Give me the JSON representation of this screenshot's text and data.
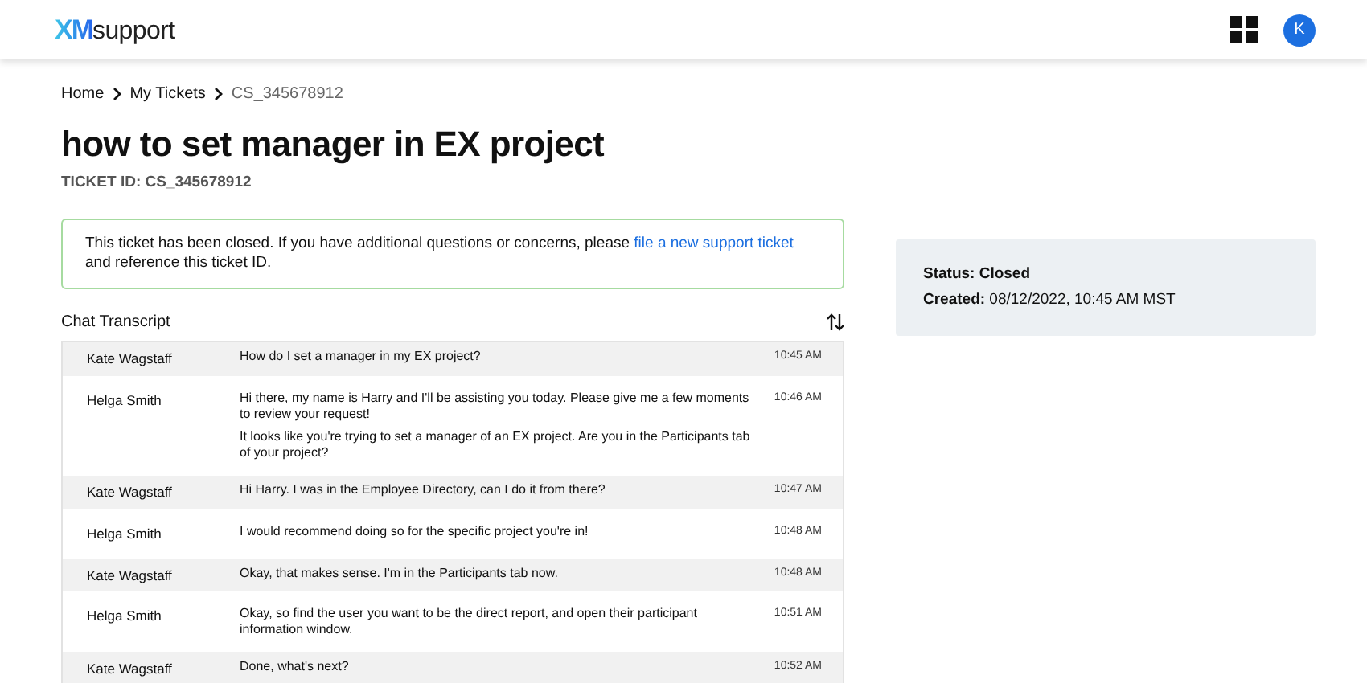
{
  "header": {
    "logo_mark": "XM",
    "logo_text": "support",
    "avatar": "K"
  },
  "breadcrumb": [
    {
      "label": "Home",
      "current": false
    },
    {
      "label": "My Tickets",
      "current": false
    },
    {
      "label": "CS_345678912",
      "current": true
    }
  ],
  "title": "how to set manager in EX project",
  "ticket_id": "TICKET ID: CS_345678912",
  "notice": {
    "text": "This ticket has been closed. If you have additional questions or concerns, please",
    "link": "file a new support ticket",
    "text_after": "and reference this ticket ID."
  },
  "transcript": {
    "heading": "Chat Transcript",
    "messages": [
      {
        "kind": "customer",
        "author": "Kate Wagstaff",
        "paragraphs": [
          "How do I set a manager in my EX project?"
        ],
        "time": "10:45 AM"
      },
      {
        "kind": "agent",
        "author": "Helga Smith",
        "paragraphs": [
          "Hi there, my name is Harry and I'll be assisting you today. Please give me a few moments to review your request!",
          "It looks like you're trying to set a manager of an EX project. Are you in the Participants tab of your project?"
        ],
        "time": "10:46 AM"
      },
      {
        "kind": "customer",
        "author": "Kate Wagstaff",
        "paragraphs": [
          "Hi Harry. I was in the Employee Directory, can I do it from there?"
        ],
        "time": "10:47 AM"
      },
      {
        "kind": "agent",
        "author": "Helga Smith",
        "paragraphs": [
          "I would recommend doing so for the specific project you're in!"
        ],
        "time": "10:48 AM"
      },
      {
        "kind": "customer",
        "author": "Kate Wagstaff",
        "paragraphs": [
          "Okay, that makes sense. I'm in the Participants tab now."
        ],
        "time": "10:48 AM"
      },
      {
        "kind": "agent",
        "author": "Helga Smith",
        "paragraphs": [
          "Okay, so find the user you want to be the direct report, and open their participant information window."
        ],
        "time": "10:51 AM"
      },
      {
        "kind": "customer",
        "author": "Kate Wagstaff",
        "paragraphs": [
          "Done, what's next?"
        ],
        "time": "10:52 AM"
      }
    ]
  },
  "details": {
    "status": "Status: Closed",
    "created": "**Created:** 08/12/2022, 10:45 AM MST"
  }
}
